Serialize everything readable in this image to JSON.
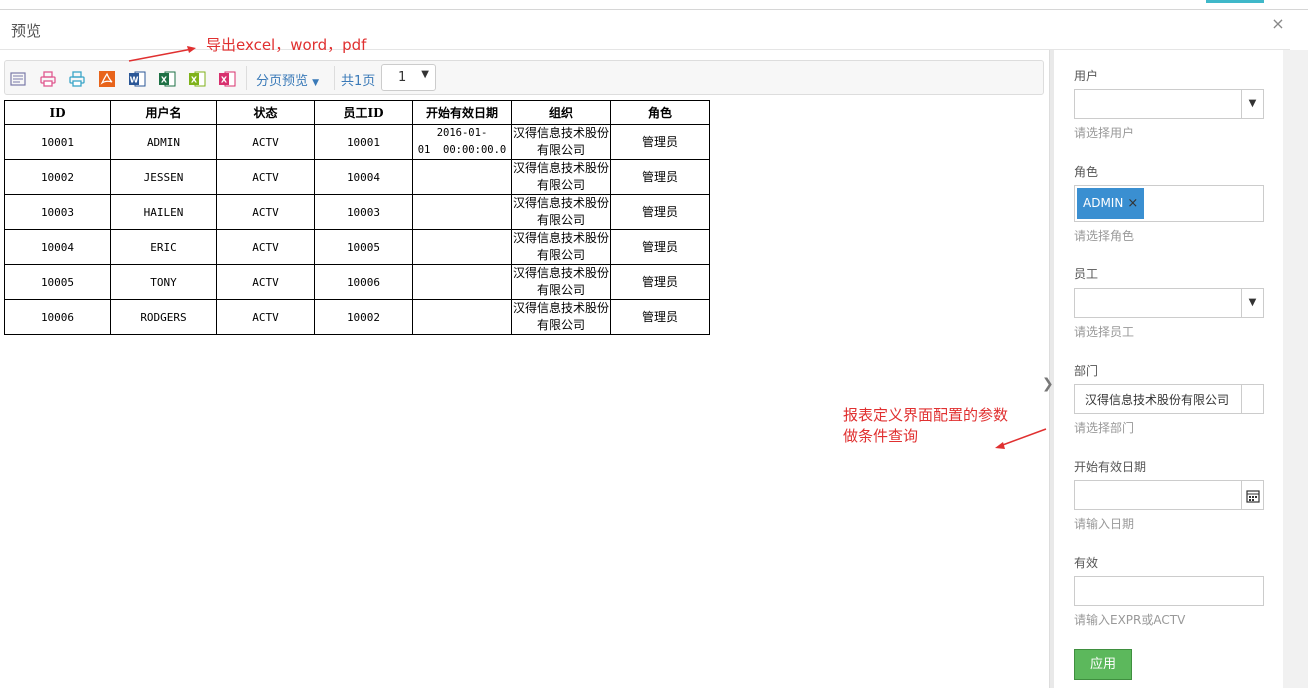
{
  "window": {
    "title": "预览",
    "close_symbol": "×"
  },
  "annotations": {
    "export_note": "导出excel，word，pdf",
    "params_note_line1": "报表定义界面配置的参数",
    "params_note_line2": "做条件查询"
  },
  "toolbar": {
    "icons": [
      "text-preview-icon",
      "print-icon",
      "print-preview-icon",
      "export-pdf-icon",
      "export-word-icon",
      "export-excel-icon",
      "export-excel-alt-icon",
      "export-excel-full-icon"
    ],
    "page_preview_label": "分页预览",
    "total_pages_label": "共1页",
    "page_select_value": "1"
  },
  "report": {
    "columns": [
      "ID",
      "用户名",
      "状态",
      "员工ID",
      "开始有效日期",
      "组织",
      "角色"
    ],
    "rows": [
      {
        "id": "10001",
        "username": "ADMIN",
        "status": "ACTV",
        "emp_id": "10001",
        "date_line1": "2016-01-",
        "date_line2": "01  00:00:00.0",
        "org_line1": "汉得信息技术股份",
        "org_line2": "有限公司",
        "role": "管理员"
      },
      {
        "id": "10002",
        "username": "JESSEN",
        "status": "ACTV",
        "emp_id": "10004",
        "date_line1": "",
        "date_line2": "",
        "org_line1": "汉得信息技术股份",
        "org_line2": "有限公司",
        "role": "管理员"
      },
      {
        "id": "10003",
        "username": "HAILEN",
        "status": "ACTV",
        "emp_id": "10003",
        "date_line1": "",
        "date_line2": "",
        "org_line1": "汉得信息技术股份",
        "org_line2": "有限公司",
        "role": "管理员"
      },
      {
        "id": "10004",
        "username": "ERIC",
        "status": "ACTV",
        "emp_id": "10005",
        "date_line1": "",
        "date_line2": "",
        "org_line1": "汉得信息技术股份",
        "org_line2": "有限公司",
        "role": "管理员"
      },
      {
        "id": "10005",
        "username": "TONY",
        "status": "ACTV",
        "emp_id": "10006",
        "date_line1": "",
        "date_line2": "",
        "org_line1": "汉得信息技术股份",
        "org_line2": "有限公司",
        "role": "管理员"
      },
      {
        "id": "10006",
        "username": "RODGERS",
        "status": "ACTV",
        "emp_id": "10002",
        "date_line1": "",
        "date_line2": "",
        "org_line1": "汉得信息技术股份",
        "org_line2": "有限公司",
        "role": "管理员"
      }
    ]
  },
  "filters": {
    "user": {
      "label": "用户",
      "value": "",
      "hint": "请选择用户"
    },
    "role": {
      "label": "角色",
      "chip": "ADMIN",
      "chip_remove": "×",
      "hint": "请选择角色"
    },
    "employee": {
      "label": "员工",
      "value": "",
      "hint": "请选择员工"
    },
    "department": {
      "label": "部门",
      "value": "汉得信息技术股份有限公司",
      "hint": "请选择部门"
    },
    "start_date": {
      "label": "开始有效日期",
      "value": "",
      "hint": "请输入日期"
    },
    "active": {
      "label": "有效",
      "value": "",
      "hint": "请输入EXPR或ACTV"
    },
    "apply_label": "应用"
  },
  "colors": {
    "annotation": "#e03030",
    "chip": "#3a8fd1",
    "apply": "#5cb85c",
    "link": "#3a7ab8"
  }
}
